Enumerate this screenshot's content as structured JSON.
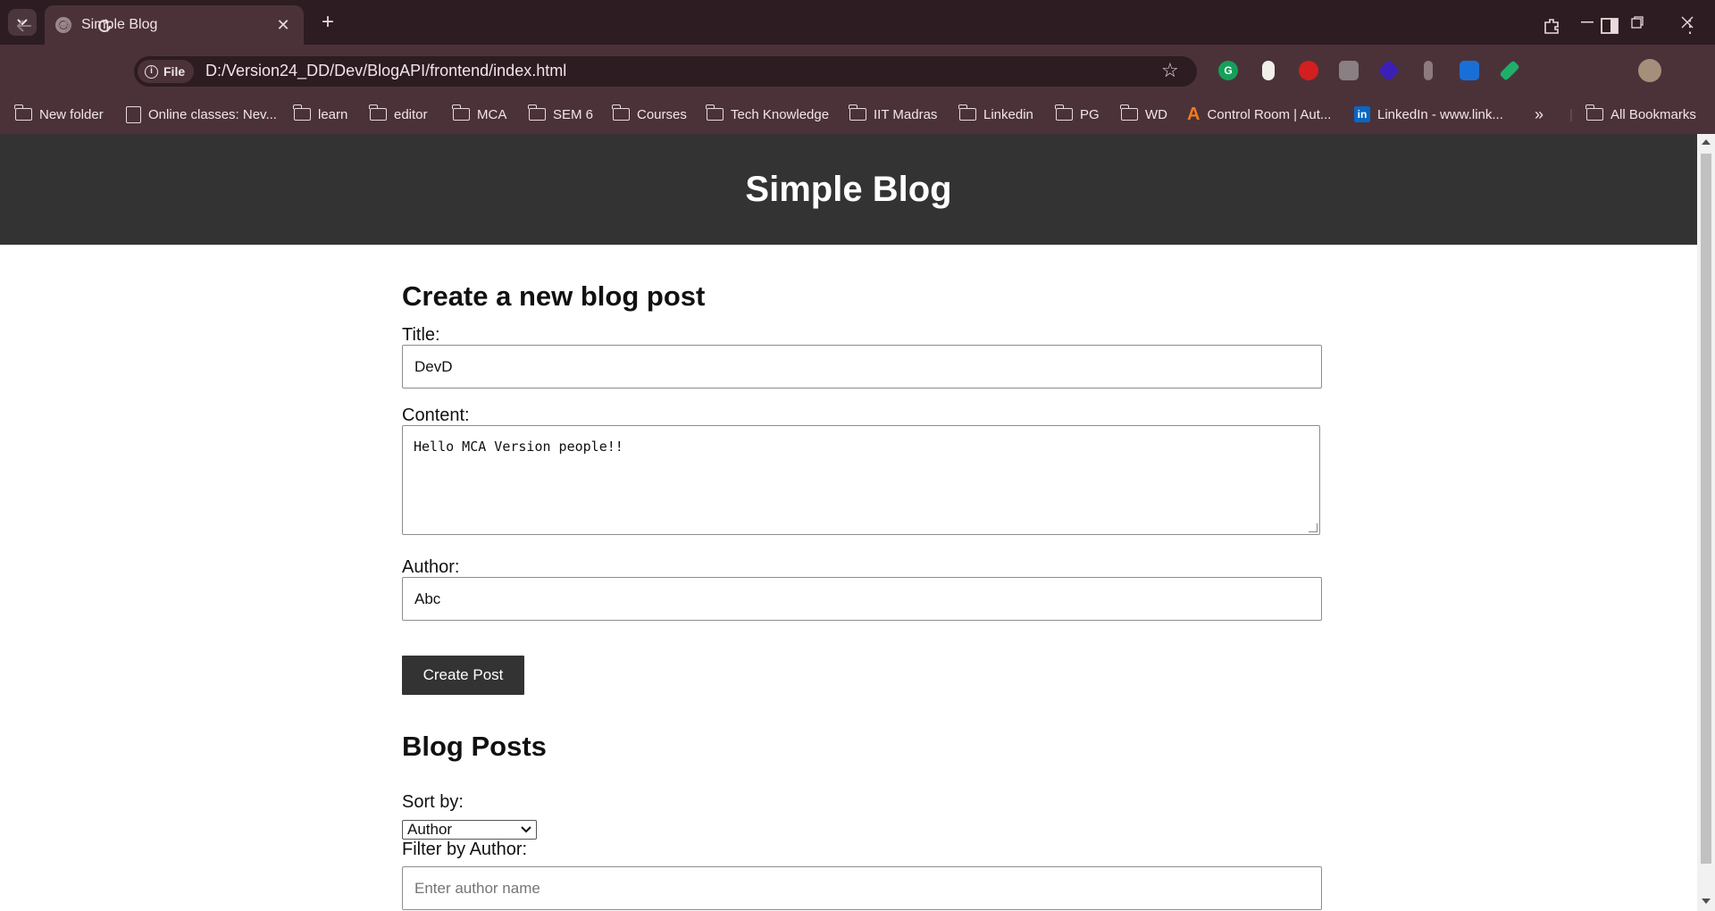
{
  "browser": {
    "tab_title": "Simple Blog",
    "site_chip": "File",
    "url": "D:/Version24_DD/Dev/BlogAPI/frontend/index.html",
    "bookmarks": [
      {
        "label": "New folder",
        "icon": "folder-icon"
      },
      {
        "label": "Online classes: Nev...",
        "icon": "bookmark-page-icon"
      },
      {
        "label": "learn",
        "icon": "folder-icon"
      },
      {
        "label": "editor",
        "icon": "folder-icon"
      },
      {
        "label": "MCA",
        "icon": "folder-icon"
      },
      {
        "label": "SEM 6",
        "icon": "folder-icon"
      },
      {
        "label": "Courses",
        "icon": "folder-icon"
      },
      {
        "label": "Tech Knowledge",
        "icon": "folder-icon"
      },
      {
        "label": "IIT Madras",
        "icon": "folder-icon"
      },
      {
        "label": "Linkedin",
        "icon": "folder-icon"
      },
      {
        "label": "PG",
        "icon": "folder-icon"
      },
      {
        "label": "WD",
        "icon": "folder-icon"
      },
      {
        "label": "Control Room | Aut...",
        "icon": "automation-anywhere-icon"
      },
      {
        "label": "LinkedIn - www.link...",
        "icon": "linkedin-icon"
      }
    ],
    "all_bookmarks": "All Bookmarks",
    "colors": {
      "frame": "#2d1c21",
      "toolbar": "#4b3239"
    }
  },
  "page": {
    "header_title": "Simple Blog",
    "create_heading": "Create a new blog post",
    "title_label": "Title:",
    "title_value": "DevD",
    "content_label": "Content:",
    "content_value": "Hello MCA Version people!!",
    "author_label": "Author:",
    "author_value": "Abc",
    "create_button": "Create Post",
    "posts_heading": "Blog Posts",
    "sort_label": "Sort by:",
    "sort_selected": "Author",
    "filter_label": "Filter by Author:",
    "filter_placeholder": "Enter author name",
    "colors": {
      "header_bg": "#333333",
      "button_bg": "#333333"
    }
  }
}
